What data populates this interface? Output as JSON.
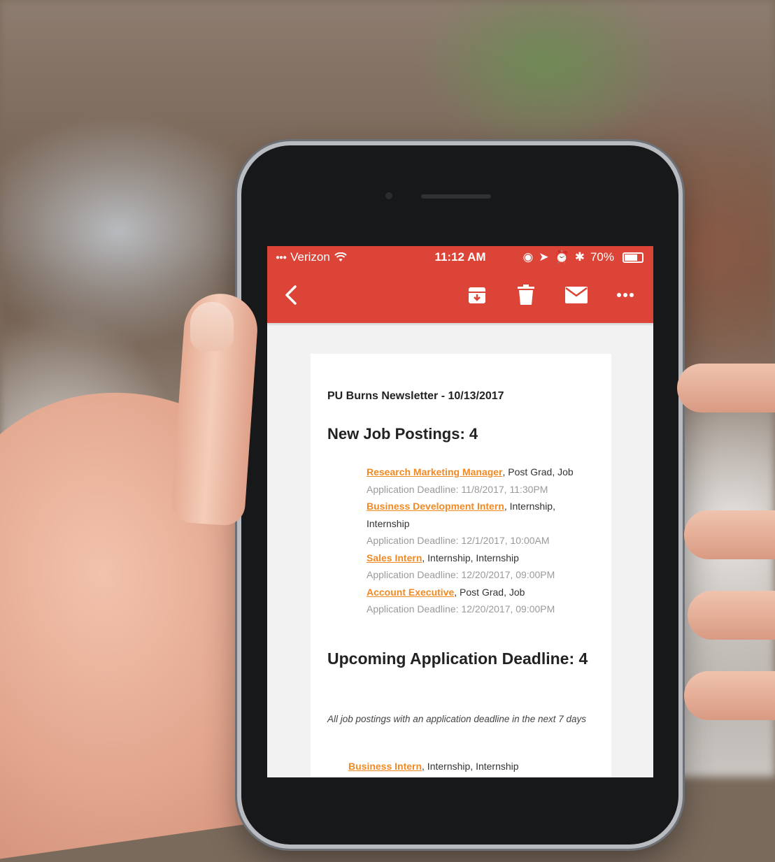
{
  "status_bar": {
    "carrier": "Verizon",
    "time": "11:12 AM",
    "battery": "70%",
    "battery_level": 0.7
  },
  "toolbar": {
    "back_icon": "chevron-left-icon",
    "archive_icon": "archive-icon",
    "delete_icon": "trash-icon",
    "mail_icon": "envelope-icon",
    "more_icon": "more-horizontal-icon"
  },
  "email": {
    "newsletter_title": "PU Burns Newsletter - 10/13/2017",
    "postings_heading": "New Job Postings: 4",
    "jobs": [
      {
        "title": "Research Marketing Manager",
        "details": ", Post Grad, Job",
        "deadline": "Application Deadline: 11/8/2017, 11:30PM"
      },
      {
        "title": "Business Development Intern",
        "details": ", Internship, Internship",
        "deadline": "Application Deadline: 12/1/2017, 10:00AM"
      },
      {
        "title": "Sales Intern",
        "details": ", Internship, Internship",
        "deadline": "Application Deadline: 12/20/2017, 09:00PM"
      },
      {
        "title": "Account Executive",
        "details": ", Post Grad, Job",
        "deadline": "Application Deadline: 12/20/2017, 09:00PM"
      }
    ],
    "upcoming_heading": "Upcoming Application Deadline: 4",
    "upcoming_note": "All job postings with an application deadline in the next 7 days",
    "upcoming_first": {
      "title": "Business Intern",
      "details": ", Internship, Internship"
    }
  },
  "colors": {
    "accent": "#db4437",
    "link": "#f08a24"
  }
}
